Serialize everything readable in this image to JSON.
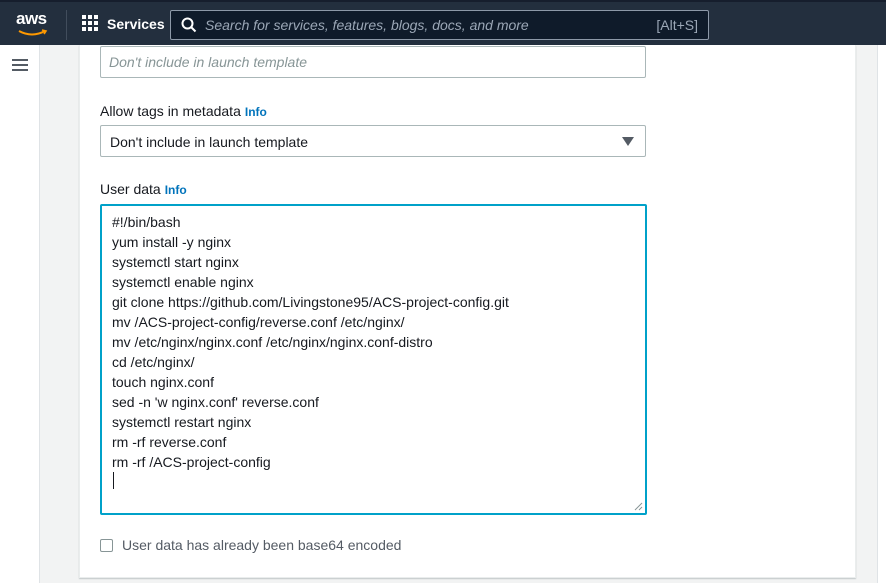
{
  "nav": {
    "logo_text": "aws",
    "services_label": "Services",
    "search_placeholder": "Search for services, features, blogs, docs, and more",
    "search_shortcut": "[Alt+S]"
  },
  "form": {
    "top_field_placeholder": "Don't include in launch template",
    "metadata_tags": {
      "label": "Allow tags in metadata",
      "info": "Info",
      "selected": "Don't include in launch template"
    },
    "user_data": {
      "label": "User data",
      "info": "Info",
      "lines": [
        "#!/bin/bash",
        "yum install -y nginx",
        "systemctl start nginx",
        "systemctl enable nginx",
        "git clone https://github.com/Livingstone95/ACS-project-config.git",
        "mv /ACS-project-config/reverse.conf /etc/nginx/",
        "mv /etc/nginx/nginx.conf /etc/nginx/nginx.conf-distro",
        "cd /etc/nginx/",
        "touch nginx.conf",
        "sed -n 'w nginx.conf' reverse.conf",
        "systemctl restart nginx",
        "rm -rf reverse.conf",
        "rm -rf /ACS-project-config"
      ]
    },
    "base64_checkbox": {
      "label": "User data has already been base64 encoded",
      "checked": false
    }
  },
  "colors": {
    "nav_bg": "#232f3e",
    "focus_border": "#00a1c9",
    "info_link": "#0073bb",
    "logo_smile": "#ff9900"
  }
}
